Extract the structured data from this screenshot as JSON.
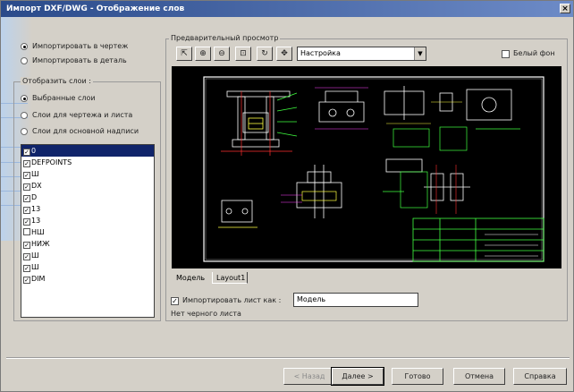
{
  "window": {
    "title": "Импорт DXF/DWG - Отображение слов",
    "close_glyph": "×"
  },
  "import_mode": {
    "options": [
      {
        "label": "Импортировать в чертеж",
        "selected": true
      },
      {
        "label": "Импортировать в деталь",
        "selected": false
      }
    ]
  },
  "layers_group": {
    "title": "Отобразить слои :",
    "options": [
      {
        "label": "Выбранные слои",
        "selected": true
      },
      {
        "label": "Слои для чертежа и листа",
        "selected": false
      },
      {
        "label": "Слои для основной надписи",
        "selected": false
      }
    ],
    "items": [
      {
        "label": "0",
        "checked": true,
        "selected": true
      },
      {
        "label": "DEFPOINTS",
        "checked": true,
        "selected": false
      },
      {
        "label": "Ш",
        "checked": true,
        "selected": false
      },
      {
        "label": "DX",
        "checked": true,
        "selected": false
      },
      {
        "label": "D",
        "checked": true,
        "selected": false
      },
      {
        "label": "13",
        "checked": true,
        "selected": false
      },
      {
        "label": "13",
        "checked": true,
        "selected": false
      },
      {
        "label": "НШ",
        "checked": false,
        "selected": false
      },
      {
        "label": "НИЖ",
        "checked": true,
        "selected": false
      },
      {
        "label": "Ш",
        "checked": true,
        "selected": false
      },
      {
        "label": "Ш",
        "checked": true,
        "selected": false
      },
      {
        "label": "DIM",
        "checked": true,
        "selected": false
      }
    ]
  },
  "preview": {
    "title": "Предварительный просмотр",
    "view_select": "Настройка",
    "white_bg_label": "Белый фон",
    "white_bg_checked": false,
    "tabs": [
      {
        "label": "Модель",
        "active": false
      },
      {
        "label": "Layout1",
        "active": true
      }
    ]
  },
  "import_sheet": {
    "label": "Импортировать лист как :",
    "checked": true,
    "value": "Модель",
    "note": "Нет черного листа"
  },
  "toolbar": {
    "icons": [
      "select-icon",
      "zoom-in-icon",
      "zoom-out-icon",
      "zoom-window-icon",
      "rotate-icon",
      "pan-icon"
    ]
  },
  "buttons": {
    "back": "< Назад",
    "next": "Далее >",
    "finish": "Готово",
    "cancel": "Отмена",
    "help": "Справка"
  },
  "colors": {
    "title_bar": "#2a4a8a",
    "drawing_bg": "#000000",
    "frame": "#ffffff"
  }
}
